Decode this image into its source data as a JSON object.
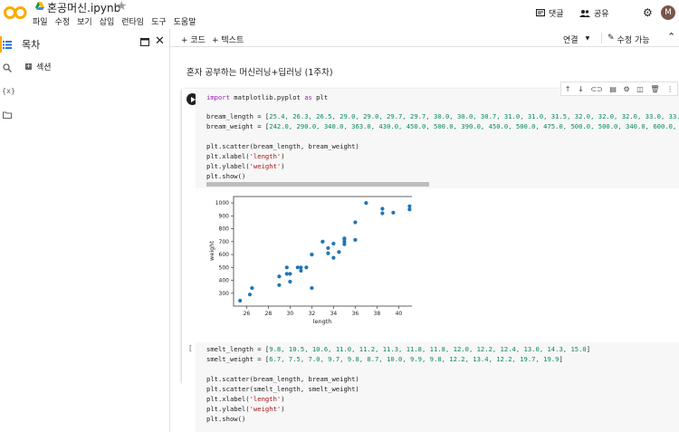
{
  "app": {
    "logo_text": "CO",
    "title": "혼공머신.ipynb"
  },
  "menu": [
    "파일",
    "수정",
    "보기",
    "삽입",
    "런타임",
    "도구",
    "도움말"
  ],
  "header_actions": {
    "comment": "댓글",
    "share": "공유",
    "avatar": "M"
  },
  "toolbar": {
    "add_code": "+ 코드",
    "add_text": "+ 텍스트",
    "connect": "연결",
    "edit_mode": "수정 가능"
  },
  "sidebar": {
    "title": "목차",
    "section": "섹션",
    "rail_vars": "{x}"
  },
  "markdown": {
    "text": "혼자 공부하는 머신러닝+딥러닝 (1주차)"
  },
  "cell1": {
    "lines": {
      "l1_import": "import",
      "l1_mod": " matplotlib.pyplot ",
      "l1_as": "as",
      "l1_alias": " plt",
      "l2_prefix": "bream_length = [",
      "l2_values": "25.4, 26.3, 26.5, 29.0, 29.0, 29.7, 29.7, 30.0, 30.0, 30.7, 31.0, 31.0, 31.5, 32.0, 32.0, 32.0, 33.0, 33.0, 33.5,",
      "l3_prefix": "bream_weight = [",
      "l3_values": "242.0, 290.0, 340.0, 363.0, 430.0, 450.0, 500.0, 390.0, 450.0, 500.0, 475.0, 500.0, 500.0, 340.0, 600.0, 600.0, 7",
      "l4": "plt.scatter(bream_length, bream_weight)",
      "l5_a": "plt.xlabel(",
      "l5_s": "'length'",
      "l5_b": ")",
      "l6_a": "plt.ylabel(",
      "l6_s": "'weight'",
      "l6_b": ")",
      "l7": "plt.show()"
    }
  },
  "chart_data": {
    "type": "scatter",
    "xlabel": "length",
    "ylabel": "weight",
    "xlim": [
      24.8,
      41.8
    ],
    "ylim": [
      200,
      1050
    ],
    "xticks": [
      26,
      28,
      30,
      32,
      34,
      36,
      38,
      40
    ],
    "yticks": [
      300,
      400,
      500,
      600,
      700,
      800,
      900,
      1000
    ],
    "color": "#1f77b4",
    "points": [
      [
        25.4,
        242
      ],
      [
        26.3,
        290
      ],
      [
        26.5,
        340
      ],
      [
        29.0,
        363
      ],
      [
        29.0,
        430
      ],
      [
        29.7,
        450
      ],
      [
        29.7,
        500
      ],
      [
        30.0,
        390
      ],
      [
        30.0,
        450
      ],
      [
        30.7,
        500
      ],
      [
        31.0,
        475
      ],
      [
        31.0,
        500
      ],
      [
        31.5,
        500
      ],
      [
        32.0,
        340
      ],
      [
        32.0,
        600
      ],
      [
        32.0,
        600
      ],
      [
        33.0,
        700
      ],
      [
        33.0,
        700
      ],
      [
        33.5,
        610
      ],
      [
        33.5,
        650
      ],
      [
        34.0,
        575
      ],
      [
        34.0,
        685
      ],
      [
        34.5,
        620
      ],
      [
        35.0,
        680
      ],
      [
        35.0,
        700
      ],
      [
        35.0,
        725
      ],
      [
        35.0,
        720
      ],
      [
        36.0,
        714
      ],
      [
        36.0,
        850
      ],
      [
        37.0,
        1000
      ],
      [
        38.5,
        920
      ],
      [
        38.5,
        955
      ],
      [
        39.5,
        925
      ],
      [
        41.0,
        975
      ],
      [
        41.0,
        950
      ]
    ]
  },
  "cell2": {
    "run_label": "[ ]",
    "s1_prefix": "smelt_length = [",
    "s1_values": "9.8, 10.5, 10.6, 11.0, 11.2, 11.3, 11.8, 11.8, 12.0, 12.2, 12.4, 13.0, 14.3, 15.0",
    "s1_suffix": "]",
    "s2_prefix": "smelt_weight = [",
    "s2_values": "6.7, 7.5, 7.0, 9.7, 9.8, 8.7, 10.0, 9.9, 9.8, 12.2, 13.4, 12.2, 19.7, 19.9",
    "s2_suffix": "]",
    "s3": "plt.scatter(bream_length, bream_weight)",
    "s4": "plt.scatter(smelt_length, smelt_weight)",
    "s5_a": "plt.xlabel(",
    "s5_s": "'length'",
    "s5_b": ")",
    "s6_a": "plt.ylabel(",
    "s6_s": "'weight'",
    "s6_b": ")",
    "s7": "plt.show()"
  }
}
